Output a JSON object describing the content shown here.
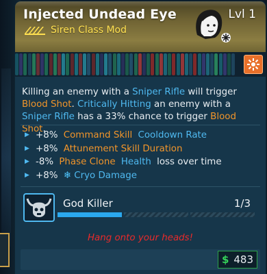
{
  "item": {
    "name": "Injected Undead Eye",
    "level": "Lvl 1",
    "class_mod": "Siren Class Mod",
    "rarity_color": "#ffe050",
    "header_color": "#8b7d42"
  },
  "strip": {
    "element_icon": "fire-burst-icon",
    "element_color": "#e8702a"
  },
  "description": {
    "s1": "Killing an enemy with a ",
    "s2": "Sniper Rifle",
    "s3": " will trigger ",
    "s4": "Blood Shot",
    "s5": ". ",
    "s6": "Critically Hitting",
    "s7": " an enemy with a ",
    "s8": "Sniper Rifle",
    "s9": " has a 33% chance to trigger ",
    "s10": "Blood Shot",
    "s11": "."
  },
  "bonuses": [
    {
      "value": "+8%",
      "a": "Command Skill",
      "b": "Cooldown Rate",
      "rest": ""
    },
    {
      "value": "+8%",
      "a": "Attunement Skill Duration",
      "b": "",
      "rest": ""
    },
    {
      "value": "-8%",
      "a": "Phase Clone",
      "b": "Health",
      "rest": "loss over time"
    },
    {
      "value": "+8%",
      "a": "",
      "b": "Cryo Damage",
      "rest": "",
      "icon": "snowflake-icon"
    }
  ],
  "skill": {
    "name": "God Killer",
    "points": "1/3",
    "points_filled": 1,
    "points_max": 3,
    "icon": "horned-skull-icon"
  },
  "flavor_text": "Hang onto your heads!",
  "price": {
    "symbol": "$",
    "amount": "483"
  }
}
